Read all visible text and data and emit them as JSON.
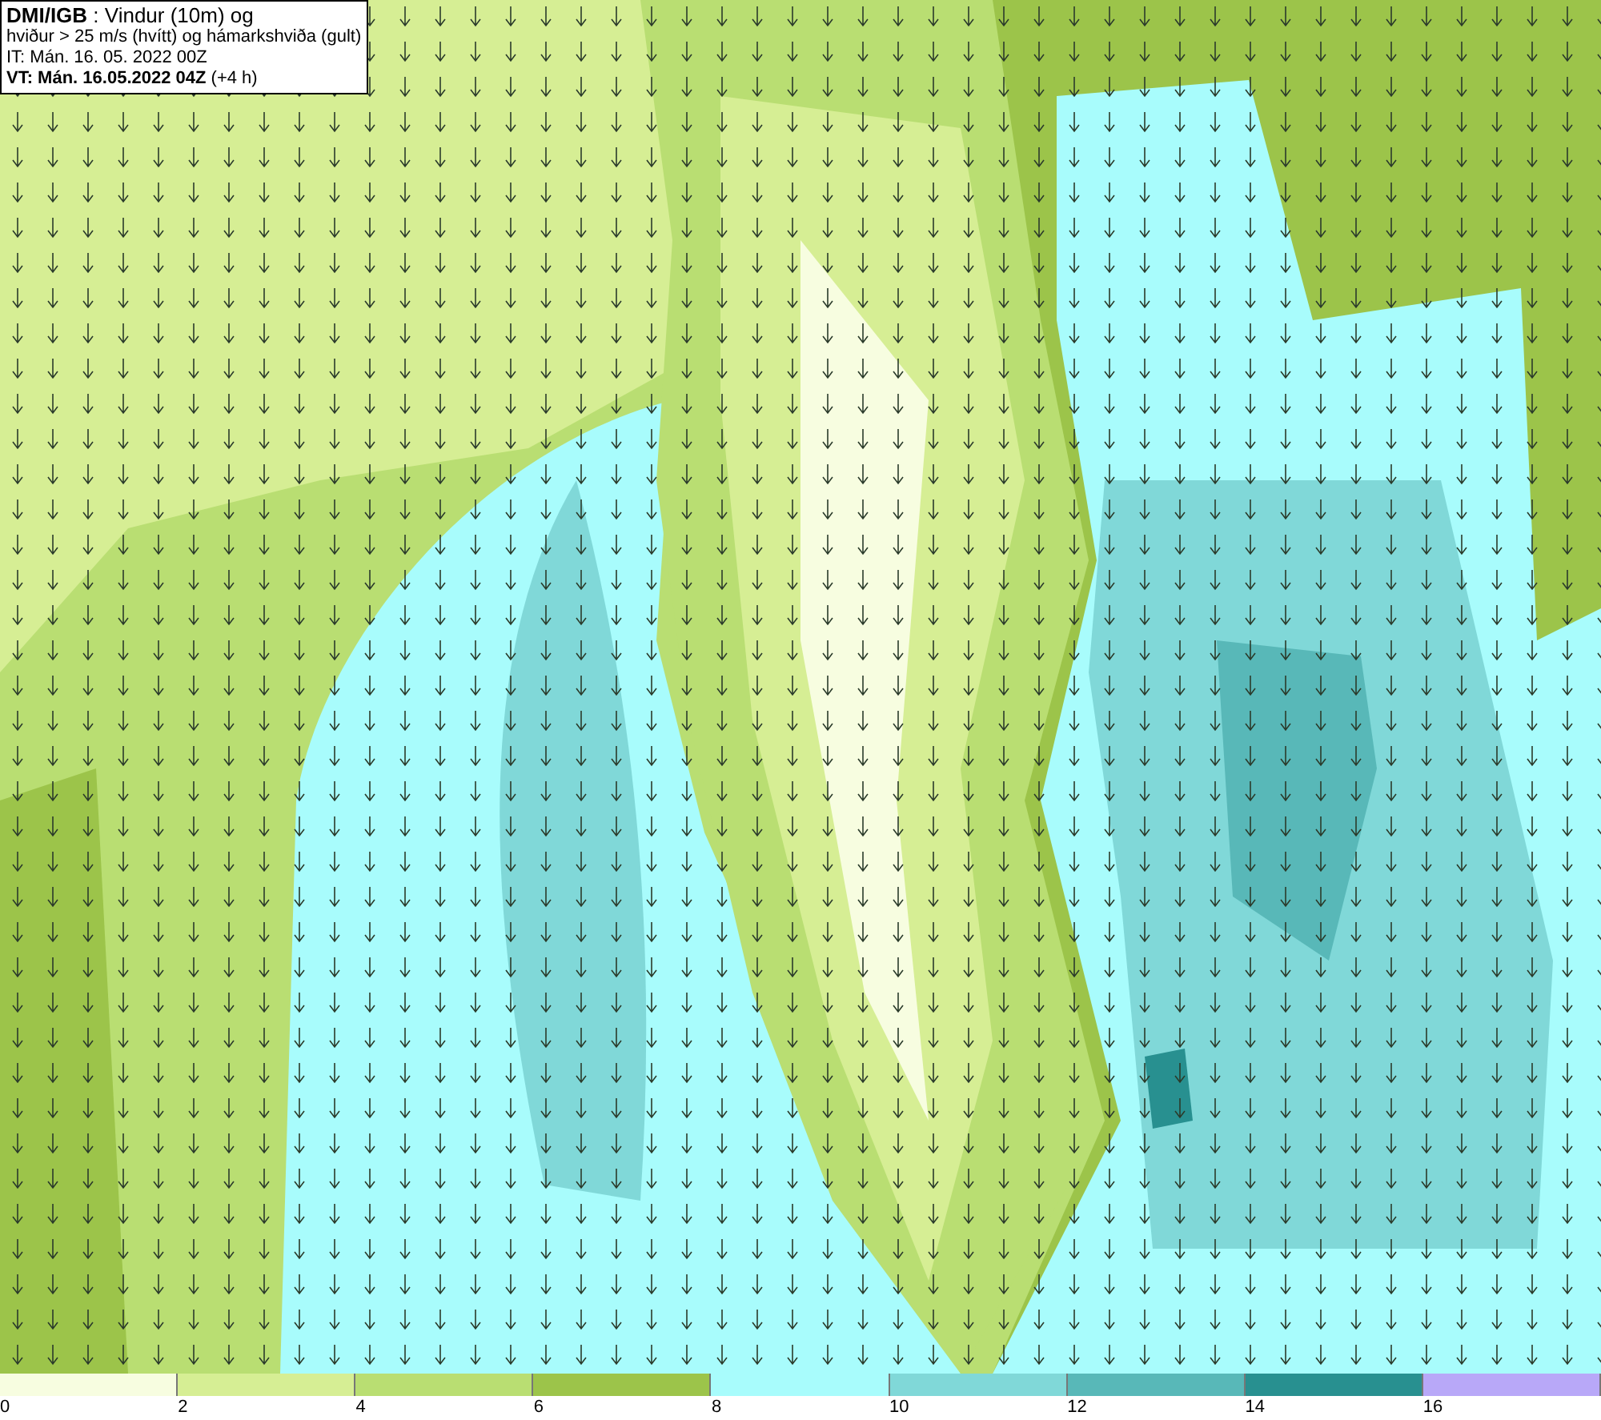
{
  "info_box": {
    "lines": [
      "**DMI/IGB** : Vindur (10m) og",
      "hviður > 25 m/s (hvítt) og hámarkshviða (gult)",
      "IT: Mán. 16. 05. 2022 00Z",
      "**VT: Mán. 16.05.2022 04Z** (+4 h)"
    ]
  },
  "legend": {
    "swatches": [
      {
        "color": "#f7fde0"
      },
      {
        "color": "#d6ee94"
      },
      {
        "color": "#b9de72"
      },
      {
        "color": "#9cc44a"
      },
      {
        "color": "#a8fcfc"
      },
      {
        "color": "#80d8d8"
      },
      {
        "color": "#58b8b8"
      },
      {
        "color": "#289090"
      },
      {
        "color": "#b8a8f8"
      }
    ],
    "labels": [
      "0",
      "2",
      "4",
      "6",
      "8",
      "10",
      "12",
      "14",
      "16"
    ]
  }
}
